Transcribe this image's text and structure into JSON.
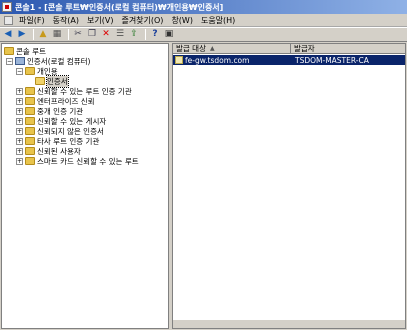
{
  "window": {
    "title": "콘솔1 - [콘솔 루트₩인증서(로컬 컴퓨터)₩개인용₩인증서]"
  },
  "menu": {
    "items": [
      "파일(F)",
      "동작(A)",
      "보기(V)",
      "즐겨찾기(O)",
      "창(W)",
      "도움말(H)"
    ]
  },
  "toolbar": {
    "icons": [
      "back-arrow-icon",
      "forward-arrow-icon",
      "up-folder-icon",
      "show-tree-icon",
      "cut-icon",
      "copy-icon",
      "delete-icon",
      "properties-icon",
      "export-icon",
      "help-icon",
      "console-icon"
    ]
  },
  "tree": {
    "root": "콘솔 루트",
    "computer": "인증서(로컬 컴퓨터)",
    "personal": "개인용",
    "certificates": "인증서",
    "stores": [
      "신뢰할 수 있는 루트 인증 기관",
      "엔터프라이즈 신뢰",
      "중개 인증 기관",
      "신뢰할 수 있는 게시자",
      "신뢰되지 않은 인증서",
      "타사 루트 인증 기관",
      "신뢰된 사용자",
      "스마트 카드 신뢰할 수 있는 루트"
    ]
  },
  "list": {
    "columns": [
      "발급 대상",
      "발급자"
    ],
    "rows": [
      {
        "issued_to": "fe-gw.tsdom.com",
        "issued_by": "TSDOM-MASTER-CA"
      }
    ]
  },
  "colors": {
    "selection": "#0a246a",
    "title_start": "#2c58b0",
    "title_end": "#8fb1e6",
    "chrome": "#d4d0c8"
  }
}
